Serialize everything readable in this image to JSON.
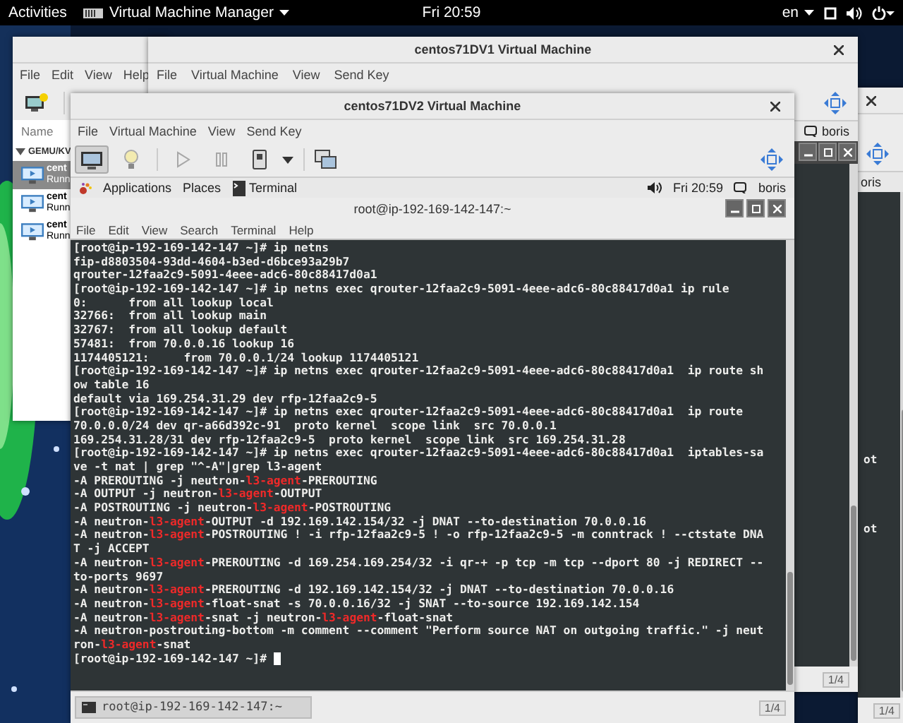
{
  "top_bar": {
    "activities": "Activities",
    "app_menu": "Virtual Machine Manager",
    "clock": "Fri 20:59",
    "language": "en"
  },
  "manager_window": {
    "menu": [
      "File",
      "Edit",
      "View",
      "Help"
    ],
    "column_header": "Name",
    "connection": {
      "label": "GEMU/KV",
      "expanded": true
    },
    "vms": [
      {
        "name": "cent",
        "status": "Runn",
        "selected": true
      },
      {
        "name": "cent",
        "status": "Runn",
        "selected": false
      },
      {
        "name": "cent",
        "status": "Runn",
        "selected": false
      }
    ]
  },
  "vm_window_1": {
    "title": "centos71DV1 Virtual Machine",
    "menu": [
      "File",
      "Virtual Machine",
      "View",
      "Send Key"
    ],
    "guest_user": "boris",
    "pager": "1/4"
  },
  "vm_window_3": {
    "guest_user": "oris",
    "terminal_lines": [
      "ot",
      "ot"
    ],
    "pager": "1/4"
  },
  "vm_window_2": {
    "title": "centos71DV2 Virtual Machine",
    "menu": [
      "File",
      "Virtual Machine",
      "View",
      "Send Key"
    ],
    "view_toggles": [
      {
        "kind": "console",
        "selected": true
      },
      {
        "kind": "details",
        "selected": false
      }
    ],
    "actions": [
      {
        "kind": "run",
        "disabled": true
      },
      {
        "kind": "pause",
        "disabled": true
      },
      {
        "kind": "shutdown",
        "disabled": false
      }
    ],
    "guest": {
      "panel": {
        "applications": "Applications",
        "places": "Places",
        "task": "Terminal",
        "clock": "Fri 20:59",
        "user": "boris"
      },
      "terminal": {
        "title": "root@ip-192-169-142-147:~",
        "menu": [
          "File",
          "Edit",
          "View",
          "Search",
          "Terminal",
          "Help"
        ],
        "cursor": true,
        "lines": [
          [
            {
              "text": "[root@ip-192-169-142-147 ~]# ip netns",
              "highlight": false
            }
          ],
          [
            {
              "text": "fip-d8803504-93dd-4604-b3ed-d6bce93a29b7",
              "highlight": false
            }
          ],
          [
            {
              "text": "qrouter-12faa2c9-5091-4eee-adc6-80c88417d0a1",
              "highlight": false
            }
          ],
          [
            {
              "text": "[root@ip-192-169-142-147 ~]# ip netns exec qrouter-12faa2c9-5091-4eee-adc6-80c88417d0a1 ip rule",
              "highlight": false
            }
          ],
          [
            {
              "text": "0:      from all lookup local",
              "highlight": false
            }
          ],
          [
            {
              "text": "32766:  from all lookup main",
              "highlight": false
            }
          ],
          [
            {
              "text": "32767:  from all lookup default",
              "highlight": false
            }
          ],
          [
            {
              "text": "57481:  from 70.0.0.16 lookup 16",
              "highlight": false
            }
          ],
          [
            {
              "text": "1174405121:     from 70.0.0.1/24 lookup 1174405121",
              "highlight": false
            }
          ],
          [
            {
              "text": "[root@ip-192-169-142-147 ~]# ip netns exec qrouter-12faa2c9-5091-4eee-adc6-80c88417d0a1  ip route sh",
              "highlight": false
            }
          ],
          [
            {
              "text": "ow table 16",
              "highlight": false
            }
          ],
          [
            {
              "text": "default via 169.254.31.29 dev rfp-12faa2c9-5",
              "highlight": false
            }
          ],
          [
            {
              "text": "[root@ip-192-169-142-147 ~]# ip netns exec qrouter-12faa2c9-5091-4eee-adc6-80c88417d0a1  ip route",
              "highlight": false
            }
          ],
          [
            {
              "text": "70.0.0.0/24 dev qr-a66d392c-91  proto kernel  scope link  src 70.0.0.1",
              "highlight": false
            }
          ],
          [
            {
              "text": "169.254.31.28/31 dev rfp-12faa2c9-5  proto kernel  scope link  src 169.254.31.28",
              "highlight": false
            }
          ],
          [
            {
              "text": "[root@ip-192-169-142-147 ~]# ip netns exec qrouter-12faa2c9-5091-4eee-adc6-80c88417d0a1  iptables-sa",
              "highlight": false
            }
          ],
          [
            {
              "text": "ve -t nat | grep \"^-A\"|grep l3-agent",
              "highlight": false
            }
          ],
          [
            {
              "text": "-A PREROUTING -j neutron-",
              "highlight": false
            },
            {
              "text": "l3-agent",
              "highlight": true
            },
            {
              "text": "-PREROUTING",
              "highlight": false
            }
          ],
          [
            {
              "text": "-A OUTPUT -j neutron-",
              "highlight": false
            },
            {
              "text": "l3-agent",
              "highlight": true
            },
            {
              "text": "-OUTPUT",
              "highlight": false
            }
          ],
          [
            {
              "text": "-A POSTROUTING -j neutron-",
              "highlight": false
            },
            {
              "text": "l3-agent",
              "highlight": true
            },
            {
              "text": "-POSTROUTING",
              "highlight": false
            }
          ],
          [
            {
              "text": "-A neutron-",
              "highlight": false
            },
            {
              "text": "l3-agent",
              "highlight": true
            },
            {
              "text": "-OUTPUT -d 192.169.142.154/32 -j DNAT --to-destination 70.0.0.16",
              "highlight": false
            }
          ],
          [
            {
              "text": "-A neutron-",
              "highlight": false
            },
            {
              "text": "l3-agent",
              "highlight": true
            },
            {
              "text": "-POSTROUTING ! -i rfp-12faa2c9-5 ! -o rfp-12faa2c9-5 -m conntrack ! --ctstate DNA",
              "highlight": false
            }
          ],
          [
            {
              "text": "T -j ACCEPT",
              "highlight": false
            }
          ],
          [
            {
              "text": "-A neutron-",
              "highlight": false
            },
            {
              "text": "l3-agent",
              "highlight": true
            },
            {
              "text": "-PREROUTING -d 169.254.169.254/32 -i qr-+ -p tcp -m tcp --dport 80 -j REDIRECT --",
              "highlight": false
            }
          ],
          [
            {
              "text": "to-ports 9697",
              "highlight": false
            }
          ],
          [
            {
              "text": "-A neutron-",
              "highlight": false
            },
            {
              "text": "l3-agent",
              "highlight": true
            },
            {
              "text": "-PREROUTING -d 192.169.142.154/32 -j DNAT --to-destination 70.0.0.16",
              "highlight": false
            }
          ],
          [
            {
              "text": "-A neutron-",
              "highlight": false
            },
            {
              "text": "l3-agent",
              "highlight": true
            },
            {
              "text": "-float-snat -s 70.0.0.16/32 -j SNAT --to-source 192.169.142.154",
              "highlight": false
            }
          ],
          [
            {
              "text": "-A neutron-",
              "highlight": false
            },
            {
              "text": "l3-agent",
              "highlight": true
            },
            {
              "text": "-snat -j neutron-",
              "highlight": false
            },
            {
              "text": "l3-agent",
              "highlight": true
            },
            {
              "text": "-float-snat",
              "highlight": false
            }
          ],
          [
            {
              "text": "-A neutron-postrouting-bottom -m comment --comment \"Perform source NAT on outgoing traffic.\" -j neut",
              "highlight": false
            }
          ],
          [
            {
              "text": "ron-",
              "highlight": false
            },
            {
              "text": "l3-agent",
              "highlight": true
            },
            {
              "text": "-snat",
              "highlight": false
            }
          ],
          [
            {
              "text": "[root@ip-192-169-142-147 ~]# ",
              "highlight": false
            }
          ]
        ]
      },
      "taskbar": {
        "task": "root@ip-192-169-142-147:~",
        "pager": "1/4"
      }
    }
  }
}
